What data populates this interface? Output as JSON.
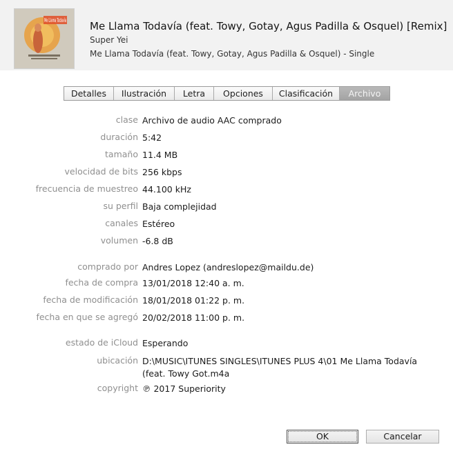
{
  "header": {
    "title": "Me Llama Todavía (feat. Towy, Gotay, Agus Padilla & Osquel) [Remix]",
    "artist": "Super Yei",
    "album": "Me Llama Todavía (feat. Towy, Gotay, Agus Padilla & Osquel) - Single",
    "artwork_text": "Me Llama Todavía"
  },
  "tabs": [
    {
      "label": "Detalles"
    },
    {
      "label": "Ilustración"
    },
    {
      "label": "Letra"
    },
    {
      "label": "Opciones"
    },
    {
      "label": "Clasificación"
    },
    {
      "label": "Archivo",
      "active": true
    }
  ],
  "file": {
    "kind_label": "clase",
    "kind": "Archivo de audio AAC comprado",
    "duration_label": "duración",
    "duration": "5:42",
    "size_label": "tamaño",
    "size": "11.4 MB",
    "bitrate_label": "velocidad de bits",
    "bitrate": "256 kbps",
    "samplerate_label": "frecuencia de muestreo",
    "samplerate": "44.100 kHz",
    "profile_label": "su perfil",
    "profile": "Baja complejidad",
    "channels_label": "canales",
    "channels": "Estéreo",
    "volume_label": "volumen",
    "volume": "-6.8 dB",
    "purchased_by_label": "comprado por",
    "purchased_by": "Andres Lopez (andreslopez@maildu.de)",
    "purchase_date_label": "fecha de compra",
    "purchase_date": "13/01/2018 12:40 a. m.",
    "modified_label": "fecha de modificación",
    "modified": "18/01/2018 01:22 p. m.",
    "added_label": "fecha en que se agregó",
    "added": "20/02/2018 11:00 p. m.",
    "icloud_label": "estado de iCloud",
    "icloud": "Esperando",
    "location_label": "ubicación",
    "location": "D:\\MUSIC\\ITUNES SINGLES\\ITUNES PLUS 4\\01 Me Llama Todavía (feat. Towy Got.m4a",
    "copyright_label": "copyright",
    "copyright": "℗ 2017 Superiority"
  },
  "buttons": {
    "ok": "OK",
    "cancel": "Cancelar"
  },
  "colors": {
    "header_bg": "#f2f2f2",
    "label": "#8f8f8f",
    "active_tab": "#a9a9a9"
  }
}
